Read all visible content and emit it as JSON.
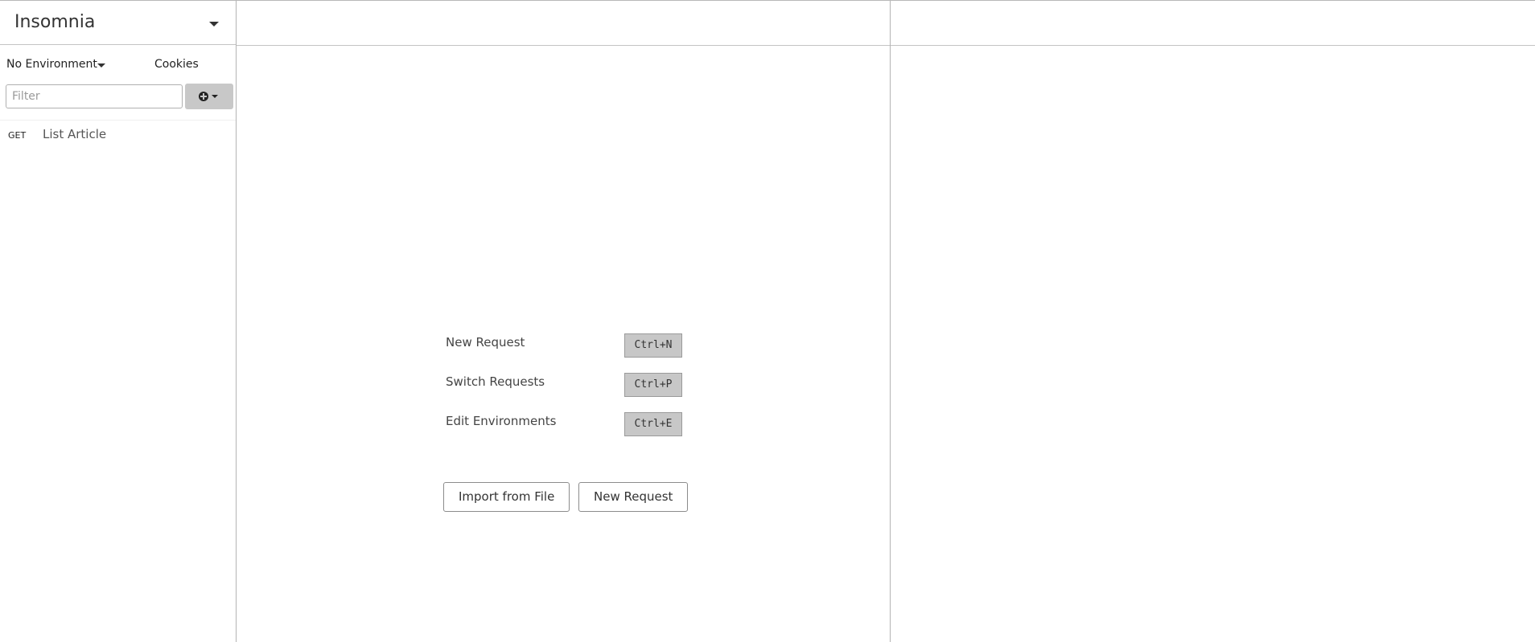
{
  "sidebar": {
    "workspace_title": "Insomnia",
    "environment_label": "No Environment",
    "cookies_label": "Cookies",
    "filter_placeholder": "Filter",
    "requests": [
      {
        "method": "GET",
        "name": "List Article"
      }
    ]
  },
  "empty_state": {
    "shortcuts": [
      {
        "label": "New Request",
        "keys": "Ctrl+N"
      },
      {
        "label": "Switch Requests",
        "keys": "Ctrl+P"
      },
      {
        "label": "Edit Environments",
        "keys": "Ctrl+E"
      }
    ],
    "import_button": "Import from File",
    "new_request_button": "New Request"
  }
}
